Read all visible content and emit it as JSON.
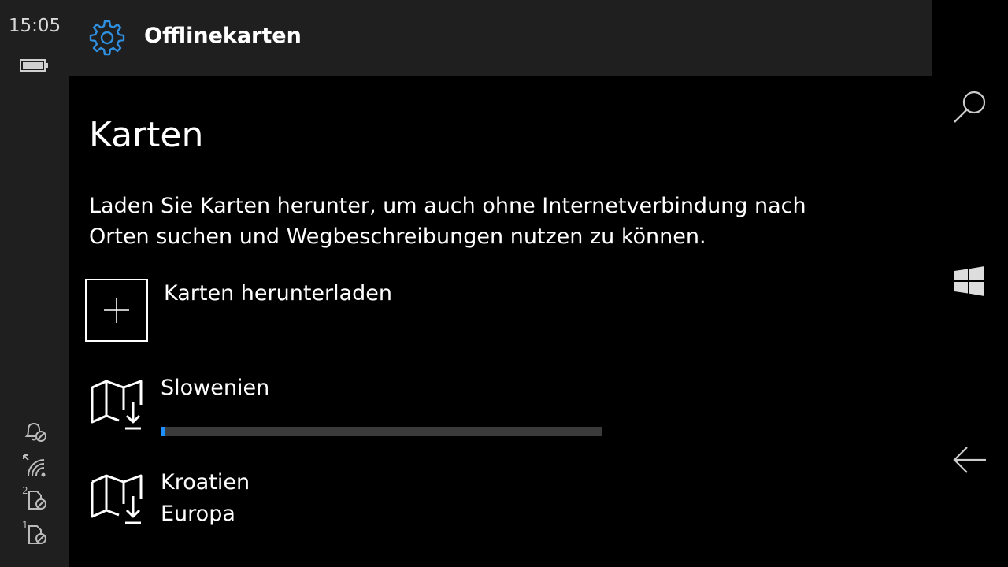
{
  "status_bar": {
    "time": "15:05",
    "icons": [
      "battery-icon",
      "quiet-hours-icon",
      "wifi-icon",
      "sim2-no-signal-icon",
      "sim1-no-signal-icon"
    ],
    "sim2_label": "2",
    "sim1_label": "1"
  },
  "header": {
    "title": "Offlinekarten",
    "icon": "gear-icon"
  },
  "main": {
    "title": "Karten",
    "description_line1": "Laden Sie Karten herunter, um auch ohne Internetverbindung nach",
    "description_line2": "Orten suchen und Wegbeschreibungen nutzen zu können.",
    "download_action": {
      "label": "Karten herunterladen",
      "icon": "plus-icon"
    },
    "maps": [
      {
        "name": "Slowenien",
        "icon": "map-download-icon",
        "progress": 0.01
      },
      {
        "name": "Kroatien",
        "subtitle": "Europa",
        "icon": "map-download-icon"
      }
    ]
  },
  "nav_bar": {
    "icons": [
      "search-icon",
      "windows-icon",
      "back-arrow-icon"
    ]
  },
  "colors": {
    "accent": "#1e90ff",
    "chrome": "#1f1f1f",
    "background": "#000000",
    "progress_track": "#3a3a3a"
  }
}
